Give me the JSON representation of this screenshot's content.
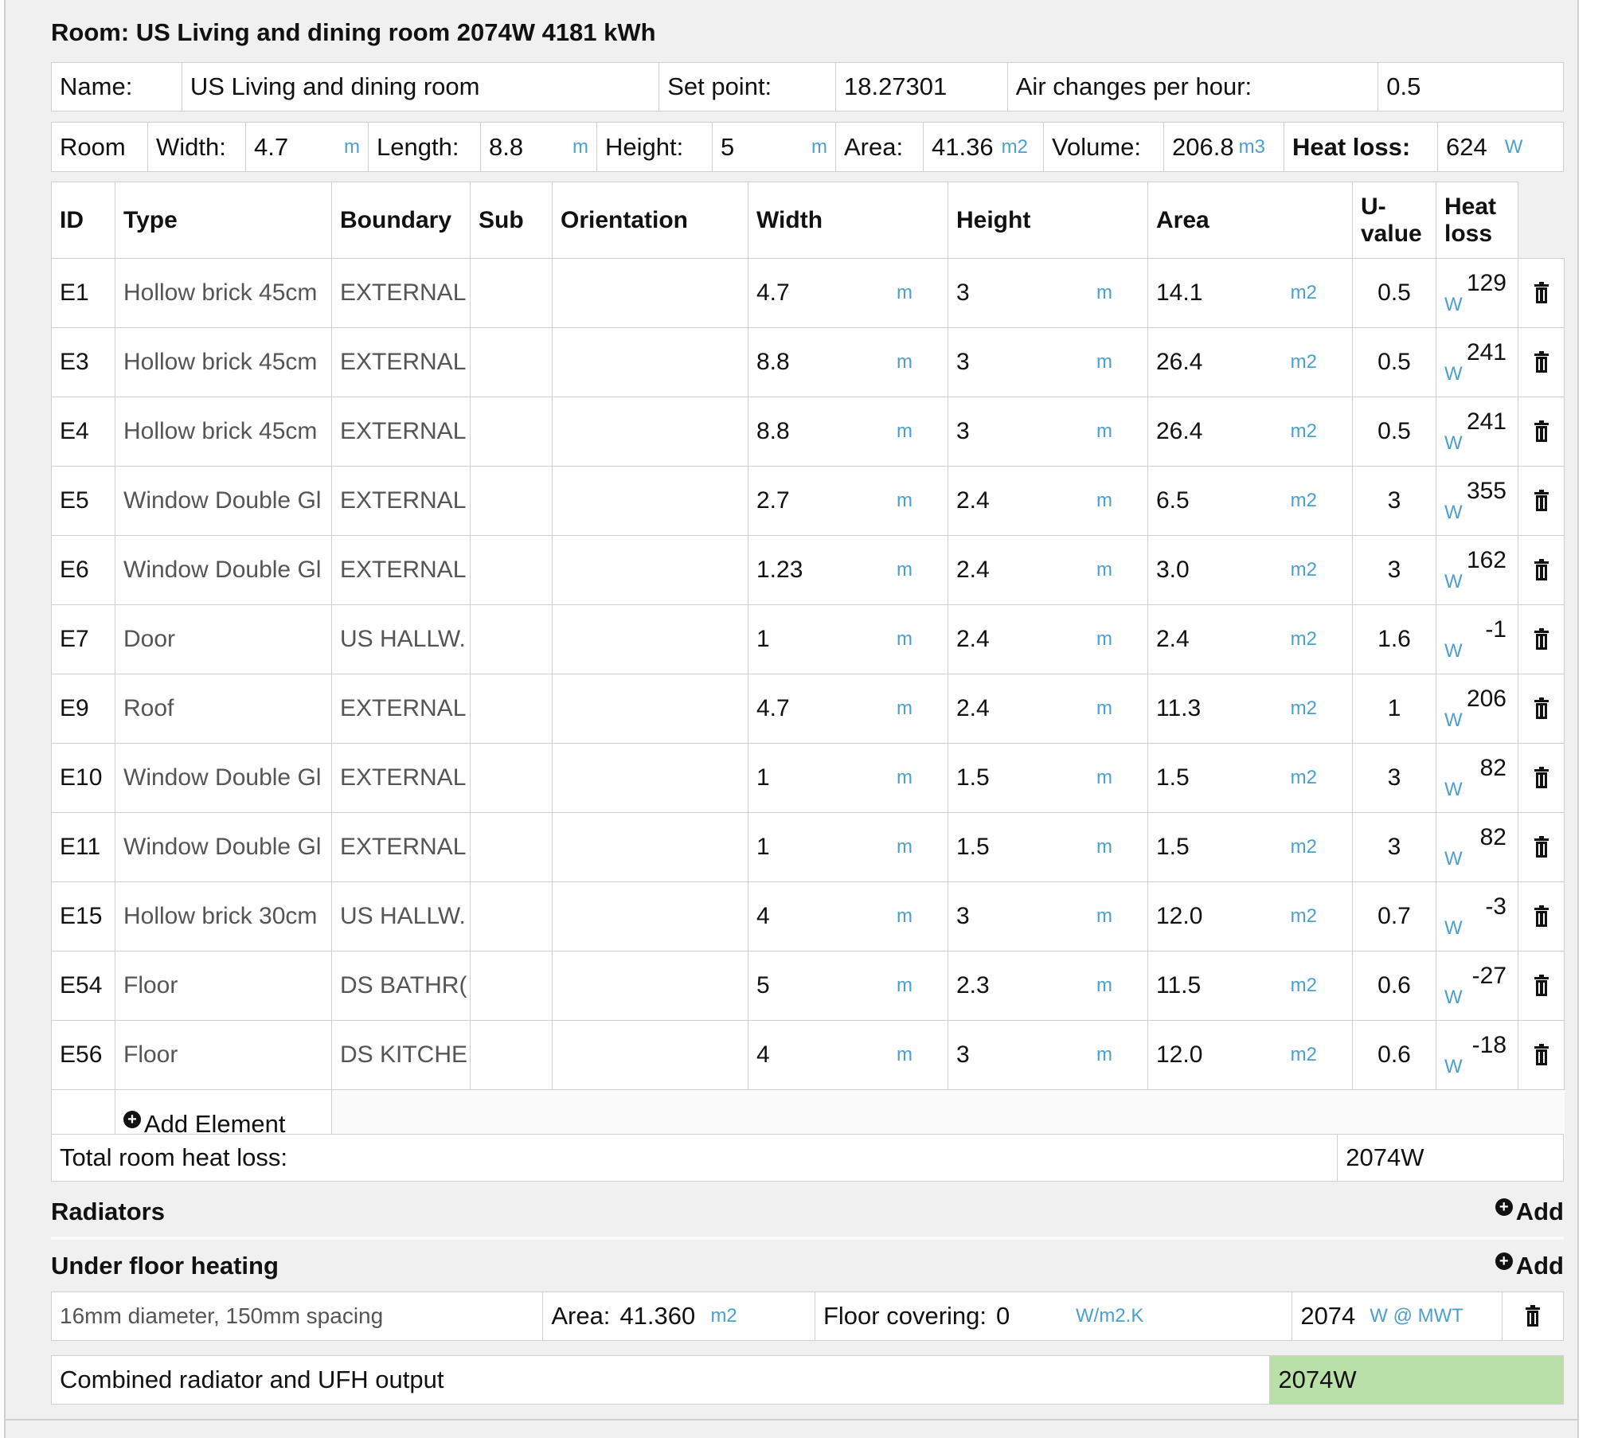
{
  "room": {
    "title": "Room: US Living and dining room 2074W 4181 kWh",
    "name_label": "Name:",
    "name_value": "US Living and dining room",
    "setpoint_label": "Set point:",
    "setpoint_value": "18.27301",
    "ach_label": "Air changes per hour:",
    "ach_value": "0.5",
    "dims": {
      "room_label": "Room",
      "width_label": "Width:",
      "width_value": "4.7",
      "width_unit": "m",
      "length_label": "Length:",
      "length_value": "8.8",
      "length_unit": "m",
      "height_label": "Height:",
      "height_value": "5",
      "height_unit": "m",
      "area_label": "Area:",
      "area_value": "41.36",
      "area_unit": "m2",
      "volume_label": "Volume:",
      "volume_value": "206.8",
      "volume_unit": "m3",
      "heatloss_label": "Heat loss:",
      "heatloss_value": "624",
      "heatloss_unit": "W"
    }
  },
  "elements": {
    "headers": [
      "ID",
      "Type",
      "Boundary",
      "Sub",
      "Orientation",
      "Width",
      "Height",
      "Area",
      "U-value",
      "Heat loss"
    ],
    "rows": [
      {
        "id": "E1",
        "type": "Hollow brick 45cm",
        "boundary": "EXTERNAL",
        "sub": "",
        "orientation": "",
        "width": "4.7",
        "height": "3",
        "area": "14.1",
        "uvalue": "0.5",
        "heatloss": "129"
      },
      {
        "id": "E3",
        "type": "Hollow brick 45cm",
        "boundary": "EXTERNAL",
        "sub": "",
        "orientation": "",
        "width": "8.8",
        "height": "3",
        "area": "26.4",
        "uvalue": "0.5",
        "heatloss": "241"
      },
      {
        "id": "E4",
        "type": "Hollow brick 45cm",
        "boundary": "EXTERNAL",
        "sub": "",
        "orientation": "",
        "width": "8.8",
        "height": "3",
        "area": "26.4",
        "uvalue": "0.5",
        "heatloss": "241"
      },
      {
        "id": "E5",
        "type": "Window Double Gl",
        "boundary": "EXTERNAL",
        "sub": "",
        "orientation": "",
        "width": "2.7",
        "height": "2.4",
        "area": "6.5",
        "uvalue": "3",
        "heatloss": "355"
      },
      {
        "id": "E6",
        "type": "Window Double Gl",
        "boundary": "EXTERNAL",
        "sub": "",
        "orientation": "",
        "width": "1.23",
        "height": "2.4",
        "area": "3.0",
        "uvalue": "3",
        "heatloss": "162"
      },
      {
        "id": "E7",
        "type": "Door",
        "boundary": "US HALLW.",
        "sub": "",
        "orientation": "",
        "width": "1",
        "height": "2.4",
        "area": "2.4",
        "uvalue": "1.6",
        "heatloss": "-1"
      },
      {
        "id": "E9",
        "type": "Roof",
        "boundary": "EXTERNAL",
        "sub": "",
        "orientation": "",
        "width": "4.7",
        "height": "2.4",
        "area": "11.3",
        "uvalue": "1",
        "heatloss": "206"
      },
      {
        "id": "E10",
        "type": "Window Double Gl",
        "boundary": "EXTERNAL",
        "sub": "",
        "orientation": "",
        "width": "1",
        "height": "1.5",
        "area": "1.5",
        "uvalue": "3",
        "heatloss": "82"
      },
      {
        "id": "E11",
        "type": "Window Double Gl",
        "boundary": "EXTERNAL",
        "sub": "",
        "orientation": "",
        "width": "1",
        "height": "1.5",
        "area": "1.5",
        "uvalue": "3",
        "heatloss": "82"
      },
      {
        "id": "E15",
        "type": "Hollow brick 30cm",
        "boundary": "US HALLW.",
        "sub": "",
        "orientation": "",
        "width": "4",
        "height": "3",
        "area": "12.0",
        "uvalue": "0.7",
        "heatloss": "-3"
      },
      {
        "id": "E54",
        "type": "Floor",
        "boundary": "DS BATHR(",
        "sub": "",
        "orientation": "",
        "width": "5",
        "height": "2.3",
        "area": "11.5",
        "uvalue": "0.6",
        "heatloss": "-27"
      },
      {
        "id": "E56",
        "type": "Floor",
        "boundary": "DS KITCHE",
        "sub": "",
        "orientation": "",
        "width": "4",
        "height": "3",
        "area": "12.0",
        "uvalue": "0.6",
        "heatloss": "-18"
      }
    ],
    "units": {
      "length": "m",
      "area": "m2",
      "power": "W"
    },
    "add_label": "Add Element"
  },
  "total": {
    "label": "Total room heat loss:",
    "value": "2074W"
  },
  "radiators": {
    "title": "Radiators",
    "add_label": "Add"
  },
  "ufh": {
    "title": "Under floor heating",
    "add_label": "Add",
    "pipe": "16mm diameter, 150mm spacing",
    "area_label": "Area:",
    "area_value": "41.360",
    "area_unit": "m2",
    "covering_label": "Floor covering:",
    "covering_value": "0",
    "covering_unit": "W/m2.K",
    "output_value": "2074",
    "output_unit": "W @ MWT"
  },
  "combined": {
    "label": "Combined radiator and UFH output",
    "value": "2074W",
    "highlight": "#b8e0a8"
  }
}
